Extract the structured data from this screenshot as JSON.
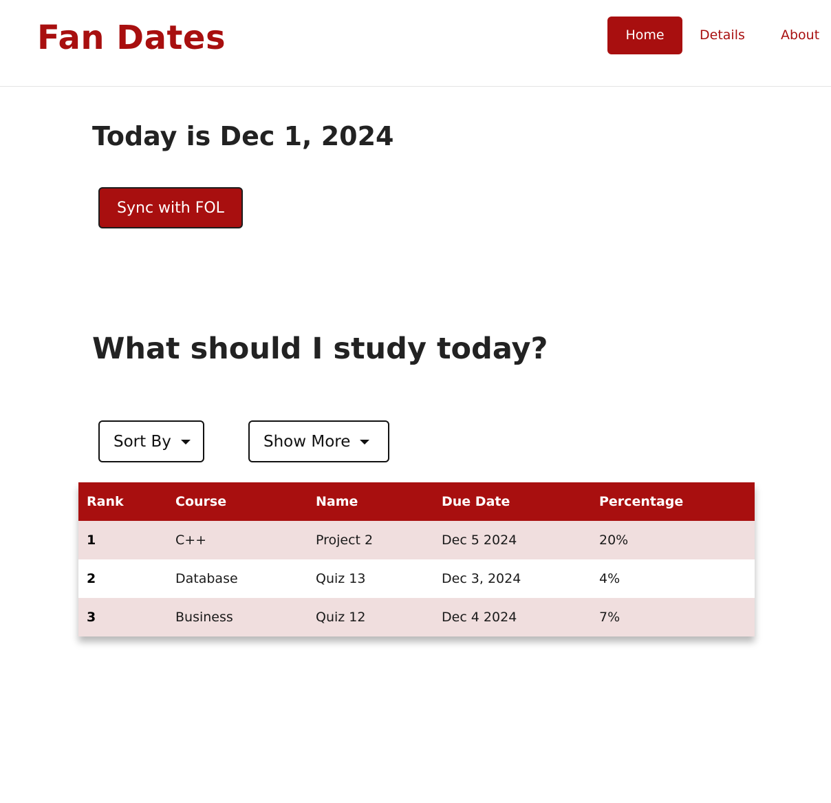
{
  "brand": "Fan Dates",
  "nav": {
    "home": "Home",
    "details": "Details",
    "about": "About"
  },
  "today": {
    "prefix": "Today is",
    "date": "Dec 1, 2024"
  },
  "sync_button": "Sync with FOL",
  "study_title": "What should I study today?",
  "controls": {
    "sort_by": "Sort By",
    "show_more": "Show More"
  },
  "table": {
    "headers": [
      "Rank",
      "Course",
      "Name",
      "Due Date",
      "Percentage"
    ],
    "rows": [
      [
        "1",
        "C++",
        "Project 2",
        "Dec 5 2024",
        "20%"
      ],
      [
        "2",
        "Database",
        "Quiz 13",
        "Dec 3, 2024",
        "4%"
      ],
      [
        "3",
        "Business",
        "Quiz 12",
        "Dec 4 2024",
        "7%"
      ]
    ]
  },
  "colors": {
    "accent": "#a80f0f",
    "row_tint": "#f0dede"
  }
}
